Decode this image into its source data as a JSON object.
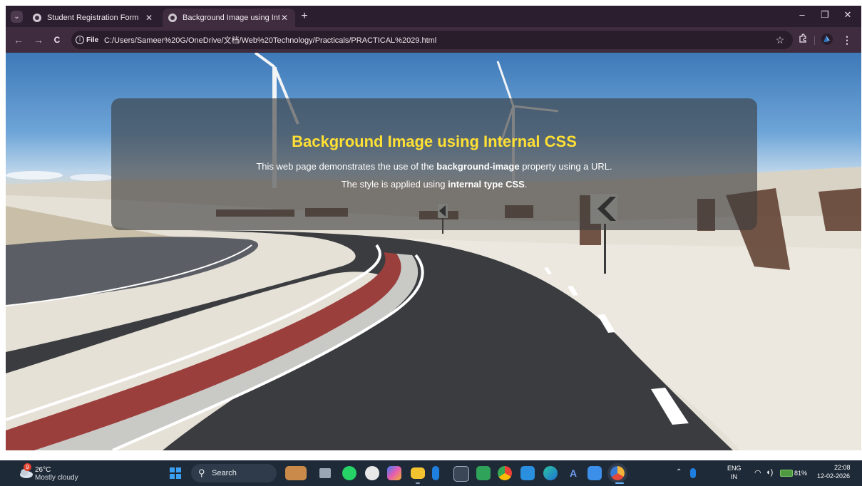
{
  "browser": {
    "tabs": [
      {
        "title": "Student Registration Form",
        "active": false
      },
      {
        "title": "Background Image using Intern",
        "active": true
      }
    ],
    "new_tab": "+",
    "window_controls": {
      "minimize": "–",
      "restore": "❐",
      "close": "✕"
    },
    "nav": {
      "back": "←",
      "forward": "→",
      "reload": "C"
    },
    "site_info_label": "File",
    "url": "C:/Users/Sameer%20G/OneDrive/文档/Web%20Technology/Practicals/PRACTICAL%2029.html",
    "toolbar_icons": [
      "star-icon",
      "extensions-icon",
      "profile-icon",
      "menu-icon"
    ]
  },
  "page": {
    "heading": "Background Image using Internal CSS",
    "line1": {
      "before": "This web page demonstrates the use of the ",
      "bold": "background-image",
      "after": " property using a URL."
    },
    "line2": {
      "before": "The style is applied using ",
      "bold": "internal type CSS",
      "after": "."
    },
    "colors": {
      "heading": "#ffe033",
      "panel": "rgba(60,60,60,0.62)"
    }
  },
  "taskbar": {
    "weather": {
      "badge": "9",
      "temp": "26°C",
      "desc": "Mostly cloudy"
    },
    "search_label": "Search",
    "apps": [
      "widgets-icon",
      "task-view-icon",
      "whatsapp-icon",
      "chatgpt-icon",
      "copilot-icon",
      "file-explorer-icon",
      "bluetooth-icon",
      "terminal-icon",
      "photos-icon",
      "chrome-icon",
      "vscode-icon",
      "edge-icon",
      "arc-icon",
      "gallery-icon",
      "chrome-canary-icon"
    ],
    "tray": {
      "lang_top": "ENG",
      "lang_bottom": "IN",
      "battery": "81%",
      "time": "22:08",
      "date": "12-02-2026"
    }
  }
}
